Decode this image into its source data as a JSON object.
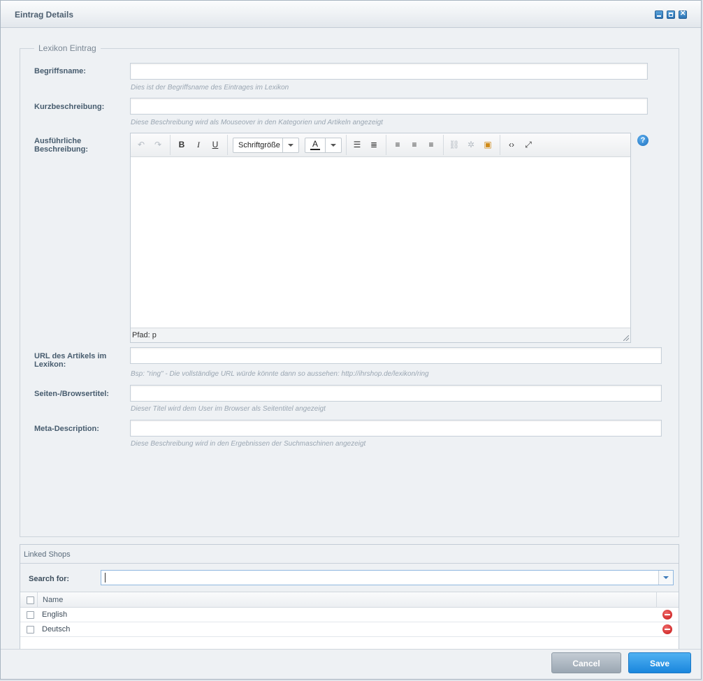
{
  "window": {
    "title": "Eintrag Details",
    "controls": [
      "minimize-icon",
      "maximize-icon",
      "close-icon"
    ]
  },
  "form": {
    "legend": "Lexikon Eintrag",
    "name_label": "Begriffsname:",
    "name_value": "",
    "name_hint": "Dies ist der Begriffsname des Eintrages im Lexikon",
    "short_label": "Kurzbeschreibung:",
    "short_value": "",
    "short_hint": "Diese Beschreibung wird als Mouseover in den Kategorien und Artikeln angezeigt",
    "long_label": "Ausführliche Beschreibung:",
    "url_label": "URL des Artikels im Lexikon:",
    "url_value": "",
    "url_hint": "Bsp: \"ring\" - Die vollständige URL würde könnte dann so aussehen: http://ihrshop.de/lexikon/ring",
    "title_label": "Seiten-/Browsertitel:",
    "title_value": "",
    "title_hint": "Dieser Titel wird dem User im Browser als Seitentitel angezeigt",
    "meta_label": "Meta-Description:",
    "meta_value": "",
    "meta_hint": "Diese Beschreibung wird in den Ergebnissen der Suchmaschinen angezeigt"
  },
  "editor": {
    "font_size_label": "Schriftgröße",
    "color_letter": "A",
    "bold": "B",
    "italic": "I",
    "underline": "U",
    "path": "Pfad: p",
    "help_symbol": "?",
    "accent_color": "#1c6fbd"
  },
  "linked_shops": {
    "title": "Linked Shops",
    "search_label": "Search for:",
    "search_value": "",
    "column_name": "Name",
    "rows": [
      {
        "name": "English"
      },
      {
        "name": "Deutsch"
      }
    ]
  },
  "footer": {
    "cancel_label": "Cancel",
    "save_label": "Save",
    "save_color": "#1a86dd"
  }
}
